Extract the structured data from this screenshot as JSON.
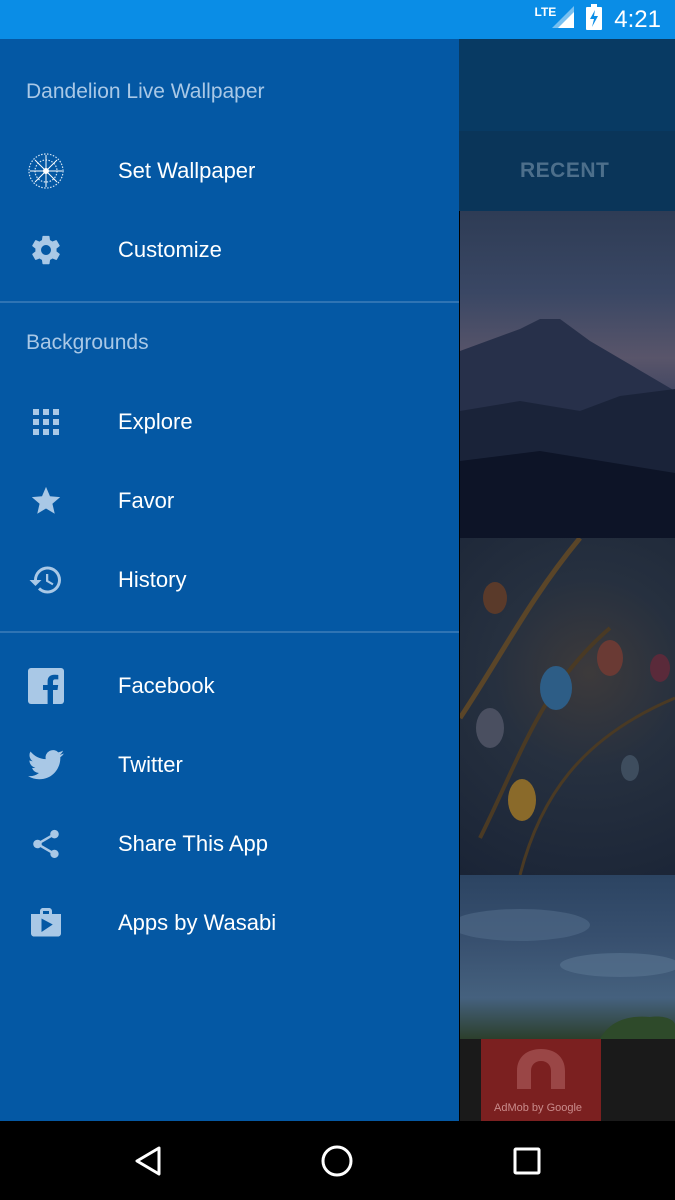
{
  "status_bar": {
    "network": "LTE",
    "time": "4:21"
  },
  "background_app": {
    "tab_recent": "RECENT",
    "ad_text": "AdMob by Google"
  },
  "drawer": {
    "title": "Dandelion Live Wallpaper",
    "items_top": [
      {
        "label": "Set Wallpaper",
        "icon": "dandelion-icon"
      },
      {
        "label": "Customize",
        "icon": "gear-icon"
      }
    ],
    "backgrounds_label": "Backgrounds",
    "items_backgrounds": [
      {
        "label": "Explore",
        "icon": "grid-icon"
      },
      {
        "label": "Favor",
        "icon": "star-icon"
      },
      {
        "label": "History",
        "icon": "history-icon"
      }
    ],
    "items_social": [
      {
        "label": "Facebook",
        "icon": "facebook-icon"
      },
      {
        "label": "Twitter",
        "icon": "twitter-icon"
      },
      {
        "label": "Share This App",
        "icon": "share-icon"
      },
      {
        "label": "Apps by Wasabi",
        "icon": "shop-bag-icon"
      }
    ]
  },
  "colors": {
    "status_bar": "#0a8de6",
    "drawer_bg": "#0458a4",
    "section_text": "#a9c8e6",
    "icon": "#a9c8e6"
  }
}
